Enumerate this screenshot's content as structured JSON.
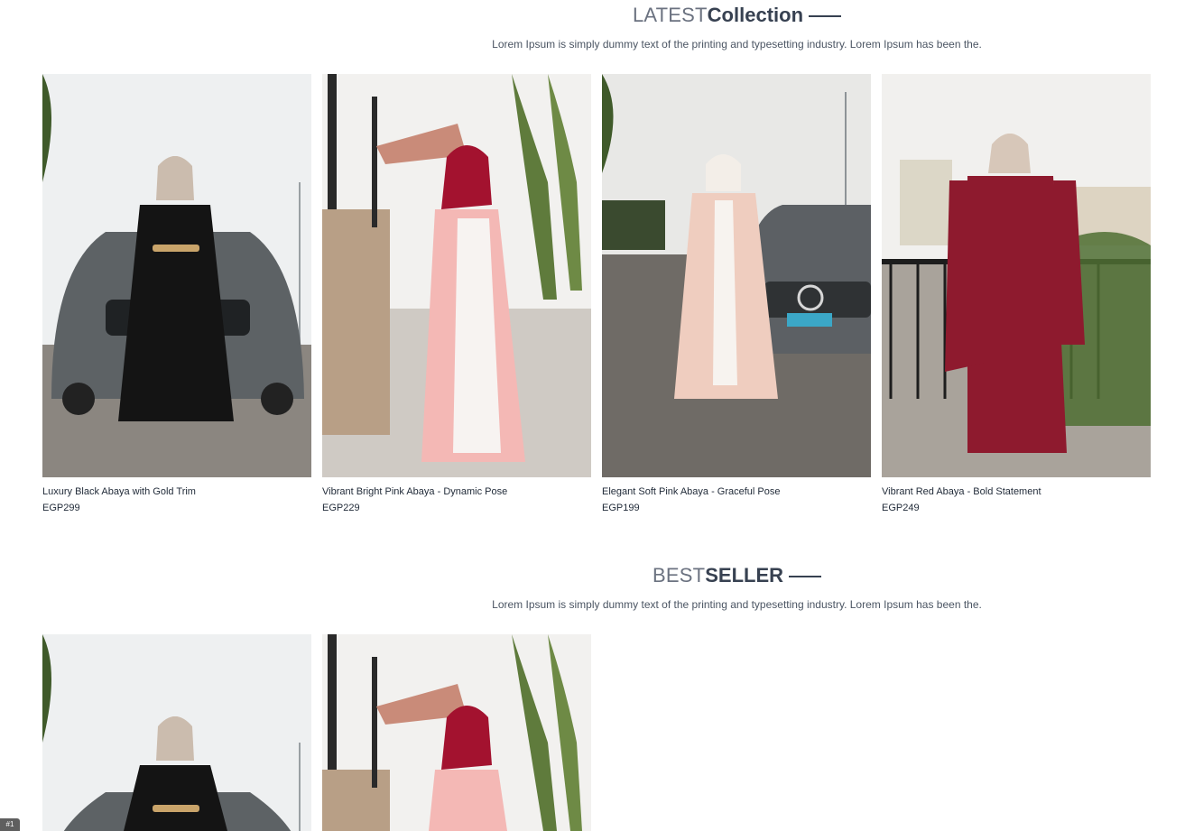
{
  "latest": {
    "title_light": "LATEST",
    "title_bold": "Collection",
    "subtitle": "Lorem Ipsum is simply dummy text of the printing and typesetting industry. Lorem Ipsum has been the.",
    "products": [
      {
        "name": "Luxury Black Abaya with Gold Trim",
        "price": "EGP299",
        "dress_color": "#141414",
        "accent": "#c9a46a"
      },
      {
        "name": "Vibrant Bright Pink Abaya - Dynamic Pose",
        "price": "EGP229",
        "dress_color": "#f4b8b5",
        "accent": "#a3122f"
      },
      {
        "name": "Elegant Soft Pink Abaya - Graceful Pose",
        "price": "EGP199",
        "dress_color": "#efcdbf",
        "accent": "#dcc4b3"
      },
      {
        "name": "Vibrant Red Abaya - Bold Statement",
        "price": "EGP249",
        "dress_color": "#8e1a2e",
        "accent": "#d8c8b8"
      }
    ]
  },
  "bestseller": {
    "title_light": "BEST",
    "title_bold": "SELLER",
    "subtitle": "Lorem Ipsum is simply dummy text of the printing and typesetting industry. Lorem Ipsum has been the.",
    "products": [
      {
        "dress_color": "#141414",
        "accent": "#c9a46a"
      },
      {
        "dress_color": "#f4b8b5",
        "accent": "#a3122f"
      }
    ]
  },
  "corner_tab": "#1"
}
